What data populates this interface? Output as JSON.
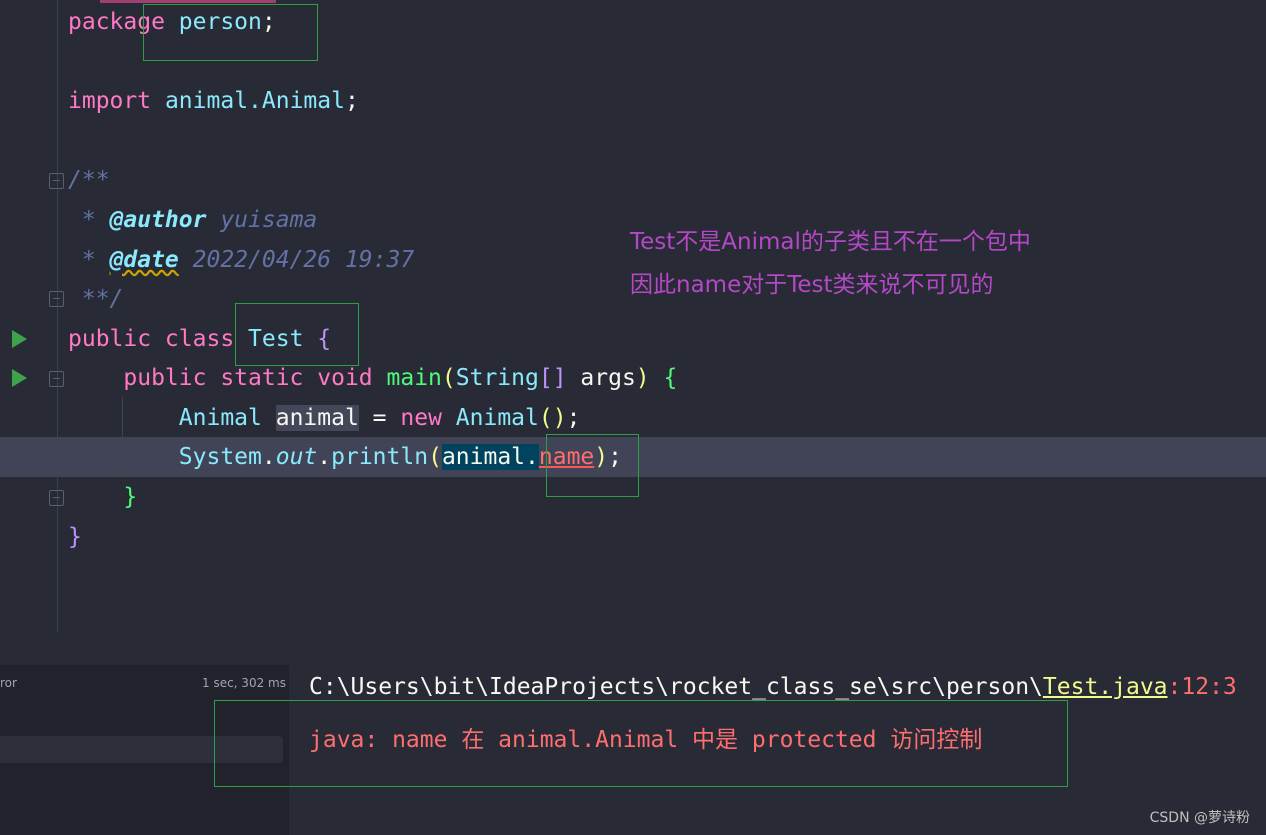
{
  "code": {
    "line1": {
      "kw": "package",
      "name": "person",
      "semi": ";"
    },
    "line2": {
      "kw": "import",
      "name": "animal.Animal",
      "semi": ";"
    },
    "doc_open": "/**",
    "author": {
      "prefix": " * ",
      "tag": "@author",
      "value": " yuisama"
    },
    "date": {
      "prefix": " * ",
      "tag": "@date",
      "value": " 2022/04/26 19:37"
    },
    "doc_close": " **/",
    "class_decl": {
      "kw": "public class",
      "name": "Test",
      "brace": "{"
    },
    "main_decl": {
      "kw1": "public static void",
      "fn": "main",
      "p_open": "(",
      "type": "String",
      "arr": "[]",
      "arg": "args",
      "p_close": ")",
      "brace": "{"
    },
    "stmt1": {
      "type": "Animal",
      "var": "animal",
      "eq": " = ",
      "kw": "new",
      "ctor": "Animal",
      "parens": "()",
      "semi": ";"
    },
    "stmt2": {
      "cls": "System",
      "dot1": ".",
      "field": "out",
      "dot2": ".",
      "method": "println",
      "p_open": "(",
      "obj": "animal",
      "dot3": ".",
      "member": "name",
      "p_close": ")",
      "semi": ";"
    },
    "close_method": "}",
    "close_class": "}"
  },
  "annotation": {
    "line1": "Test不是Animal的子类且不在一个包中",
    "line2": "因此name对于Test类来说不可见的"
  },
  "build_panel": {
    "label": "ror",
    "time": "1 sec, 302 ms"
  },
  "output": {
    "path_prefix": "C:\\Users\\bit\\IdeaProjects\\rocket_class_se\\src\\person\\",
    "file": "Test.java",
    "position": ":12:3",
    "message": "java: name 在 animal.Animal 中是 protected 访问控制"
  },
  "watermark": "CSDN @萝诗粉",
  "colors": {
    "background": "#282a36",
    "keyword": "#ff79c6",
    "type": "#8be9fd",
    "function": "#50fa7b",
    "error": "#ff6e6e",
    "annotation": "#b548c6",
    "box": "#2ea043"
  }
}
